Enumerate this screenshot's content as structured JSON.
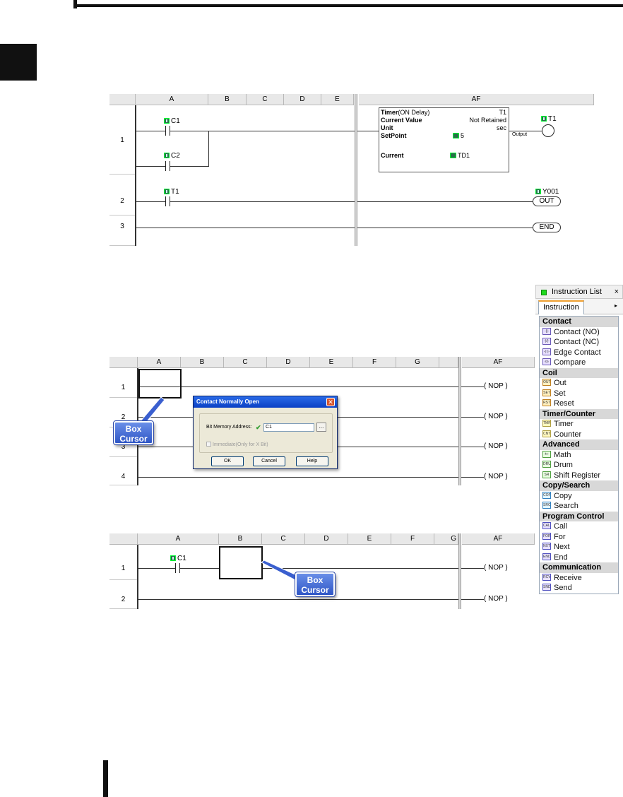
{
  "ladder1": {
    "columns": [
      "A",
      "B",
      "C",
      "D",
      "E",
      "AF"
    ],
    "rows": [
      "1",
      "2",
      "3"
    ],
    "contacts": [
      "C1",
      "C2",
      "T1"
    ],
    "timer": {
      "title_bold": "Timer",
      "title_rest": "(ON Delay)",
      "name": "T1",
      "current_value_label": "Current Value",
      "current_value": "Not Retained",
      "unit_label": "Unit",
      "unit": "sec",
      "setpoint_label": "SetPoint",
      "setpoint": "5",
      "current_label": "Current",
      "current": "TD1",
      "output_label": "Output"
    },
    "outputs": {
      "timer_coil": "T1",
      "out_address": "Y001",
      "out": "OUT",
      "end": "END"
    }
  },
  "ladder2": {
    "columns": [
      "A",
      "B",
      "C",
      "D",
      "E",
      "F",
      "G",
      "AF"
    ],
    "rows": [
      "1",
      "2",
      "3",
      "4"
    ],
    "nop": "NOP",
    "callout": {
      "line1": "Box",
      "line2": "Cursor"
    }
  },
  "dialog": {
    "title": "Contact Normally Open",
    "close": "✕",
    "bit_label": "Bit Memory Address:",
    "check": "✔",
    "value": "C1",
    "browse": "...",
    "immediate": "Immediate(Only for X Bit)",
    "ok": "OK",
    "cancel": "Cancel",
    "help": "Help"
  },
  "ladder3": {
    "columns": [
      "A",
      "B",
      "C",
      "D",
      "E",
      "F",
      "G",
      "AF"
    ],
    "rows": [
      "1",
      "2"
    ],
    "contact": "C1",
    "nop": "NOP",
    "callout": {
      "line1": "Box",
      "line2": "Cursor"
    }
  },
  "instruction_list": {
    "title": "Instruction List",
    "close": "×",
    "tab": "Instruction",
    "tab_arrow": "▸",
    "categories": [
      {
        "name": "Contact",
        "items": [
          {
            "label": "Contact (NO)",
            "icon": "contact-no-icon",
            "glyph": "-||-",
            "style": "c"
          },
          {
            "label": "Contact (NC)",
            "icon": "contact-nc-icon",
            "glyph": "-|/|-",
            "style": "c"
          },
          {
            "label": "Edge Contact",
            "icon": "edge-contact-icon",
            "glyph": "-|↑|-",
            "style": "c"
          },
          {
            "label": "Compare",
            "icon": "compare-icon",
            "glyph": "≤≥",
            "style": "c"
          }
        ]
      },
      {
        "name": "Coil",
        "items": [
          {
            "label": "Out",
            "icon": "out-coil-icon",
            "glyph": "OUT",
            "style": "o"
          },
          {
            "label": "Set",
            "icon": "set-coil-icon",
            "glyph": "SET",
            "style": "o"
          },
          {
            "label": "Reset",
            "icon": "reset-coil-icon",
            "glyph": "RST",
            "style": "o"
          }
        ]
      },
      {
        "name": "Timer/Counter",
        "items": [
          {
            "label": "Timer",
            "icon": "timer-icon",
            "glyph": "TMR",
            "style": "t"
          },
          {
            "label": "Counter",
            "icon": "counter-icon",
            "glyph": "CNT",
            "style": "t"
          }
        ]
      },
      {
        "name": "Advanced",
        "items": [
          {
            "label": "Math",
            "icon": "math-icon",
            "glyph": "±÷",
            "style": "g"
          },
          {
            "label": "Drum",
            "icon": "drum-icon",
            "glyph": "DRUM",
            "style": "g"
          },
          {
            "label": "Shift Register",
            "icon": "shift-register-icon",
            "glyph": "SR",
            "style": "g"
          }
        ]
      },
      {
        "name": "Copy/Search",
        "items": [
          {
            "label": "Copy",
            "icon": "copy-icon",
            "glyph": "COPY",
            "style": "b"
          },
          {
            "label": "Search",
            "icon": "search-icon",
            "glyph": "SRCH",
            "style": "b"
          }
        ]
      },
      {
        "name": "Program Control",
        "items": [
          {
            "label": "Call",
            "icon": "call-icon",
            "glyph": "CALL",
            "style": "p"
          },
          {
            "label": "For",
            "icon": "for-icon",
            "glyph": "FOR",
            "style": "p"
          },
          {
            "label": "Next",
            "icon": "next-icon",
            "glyph": "NXT",
            "style": "p"
          },
          {
            "label": "End",
            "icon": "end-icon",
            "glyph": "END",
            "style": "p"
          }
        ]
      },
      {
        "name": "Communication",
        "items": [
          {
            "label": "Receive",
            "icon": "receive-icon",
            "glyph": "RCV",
            "style": "p"
          },
          {
            "label": "Send",
            "icon": "send-icon",
            "glyph": "SND",
            "style": "p"
          }
        ]
      }
    ]
  }
}
